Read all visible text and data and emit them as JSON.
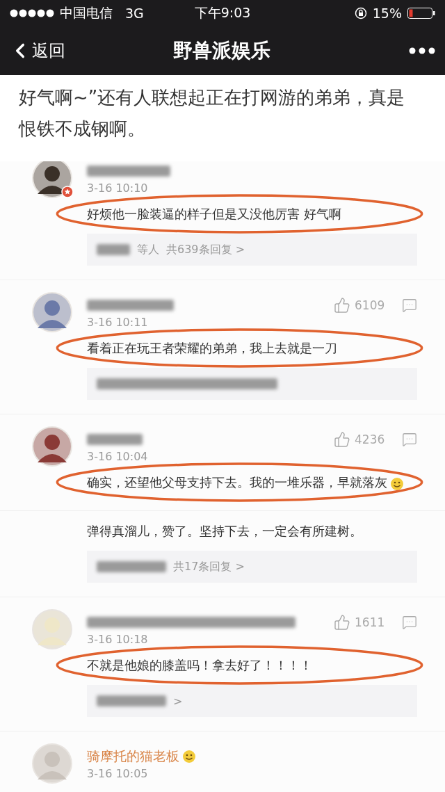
{
  "status_bar": {
    "carrier": "中国电信",
    "network": "3G",
    "time": "下午9:03",
    "battery": "15%"
  },
  "nav": {
    "back": "返回",
    "title": "野兽派娱乐"
  },
  "article": {
    "text": "好气啊~”还有人联想起正在打网游的弟弟，真是恨铁不成钢啊。"
  },
  "comments": [
    {
      "badge": true,
      "date": "3-16 10:10",
      "text": "好烦他一脸装逼的样子但是又没他厉害 好气啊",
      "circled": true,
      "reply": {
        "kind": "summary",
        "texts": [
          "等人",
          "共639条回复 >"
        ]
      }
    },
    {
      "likes": "6109",
      "date": "3-16 10:11",
      "text": "看着正在玩王者荣耀的弟弟，我上去就是一刀",
      "circled": true,
      "reply": {
        "kind": "blurred"
      }
    },
    {
      "likes": "4236",
      "date": "3-16 10:04",
      "text": "确实，还望他父母支持下去。我的一堆乐器，早就落灰",
      "emoji": true,
      "circled": true,
      "sub_text": "弹得真溜儿，赞了。坚持下去，一定会有所建树。",
      "reply": {
        "kind": "summary",
        "texts": [
          "共17条回复 >"
        ]
      }
    },
    {
      "likes": "1611",
      "date": "3-16 10:18",
      "text": "不就是他娘的膝盖吗！拿去好了！！！！",
      "circled": true,
      "reply": {
        "kind": "summary",
        "texts": [
          ">"
        ]
      }
    },
    {
      "name": "骑摩托的猫老板",
      "name_emoji": true,
      "date": "3-16 10:05"
    }
  ]
}
